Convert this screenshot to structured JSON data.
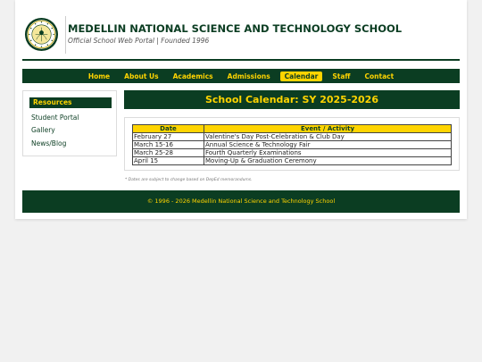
{
  "header": {
    "school_name": "MEDELLIN NATIONAL SCIENCE AND TECHNOLOGY SCHOOL",
    "tagline": "Official School Web Portal | Founded 1996"
  },
  "nav": {
    "items": [
      {
        "label": "Home",
        "active": false
      },
      {
        "label": "About Us",
        "active": false
      },
      {
        "label": "Academics",
        "active": false
      },
      {
        "label": "Admissions",
        "active": false
      },
      {
        "label": "Calendar",
        "active": true
      },
      {
        "label": "Staff",
        "active": false
      },
      {
        "label": "Contact",
        "active": false
      }
    ]
  },
  "sidebar": {
    "heading": "Resources",
    "links": [
      "Student Portal",
      "Gallery",
      "News/Blog"
    ]
  },
  "main": {
    "title": "School Calendar: SY 2025-2026",
    "table": {
      "headers": [
        "Date",
        "Event / Activity"
      ],
      "rows": [
        [
          "February 27",
          "Valentine's Day Post-Celebration & Club Day"
        ],
        [
          "March 15-16",
          "Annual Science & Technology Fair"
        ],
        [
          "March 25-28",
          "Fourth Quarterly Examinations"
        ],
        [
          "April 15",
          "Moving-Up & Graduation Ceremony"
        ]
      ]
    },
    "note": "* Dates are subject to change based on DepEd memorandums."
  },
  "footer": {
    "text": "© 1996 - 2026 Medellin National Science and Technology School"
  },
  "colors": {
    "primary_green": "#0b3d22",
    "accent_yellow": "#ffd400"
  },
  "icons": {
    "seal": "school-seal-icon"
  }
}
